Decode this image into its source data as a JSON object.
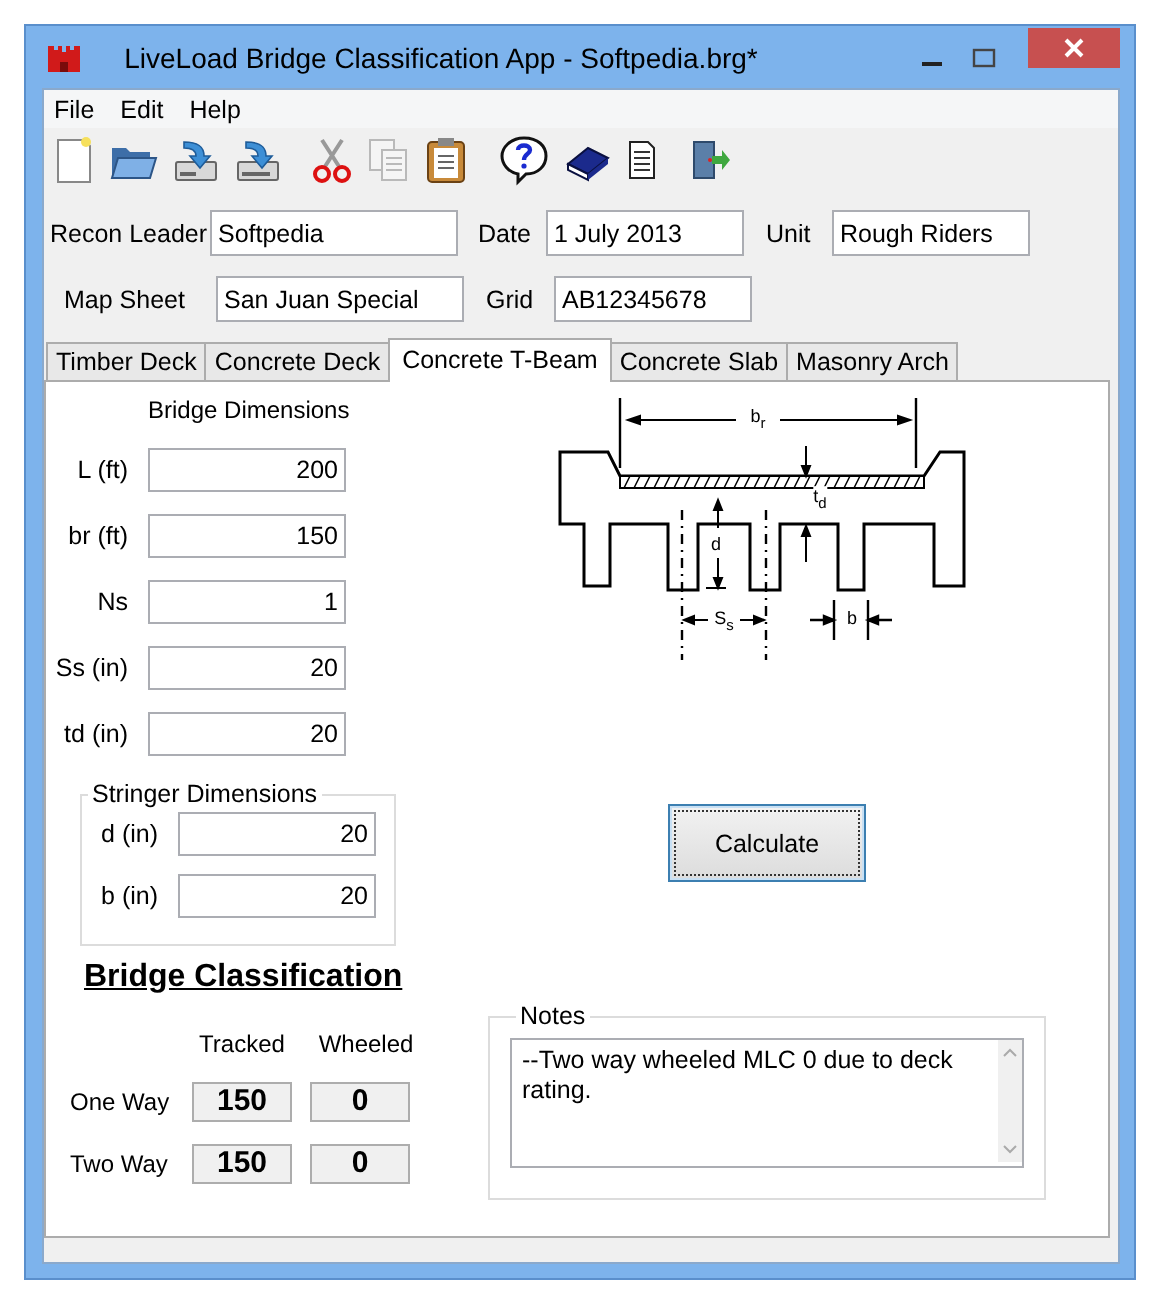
{
  "window": {
    "title": "LiveLoad Bridge Classification App - Softpedia.brg*"
  },
  "menu": [
    "File",
    "Edit",
    "Help"
  ],
  "toolbar": [
    [
      {
        "kind": "new",
        "disabled": false
      },
      {
        "kind": "open",
        "disabled": false
      },
      {
        "kind": "save",
        "disabled": false
      },
      {
        "kind": "saveas",
        "disabled": false
      }
    ],
    [
      {
        "kind": "cut",
        "disabled": false
      },
      {
        "kind": "copy",
        "disabled": true
      },
      {
        "kind": "paste",
        "disabled": false
      }
    ],
    [
      {
        "kind": "help",
        "disabled": false
      },
      {
        "kind": "book",
        "disabled": false
      },
      {
        "kind": "document",
        "disabled": false
      }
    ],
    [
      {
        "kind": "exit",
        "disabled": false
      }
    ]
  ],
  "header_rows": [
    [
      {
        "label": "Recon Leader",
        "value": "Softpedia"
      },
      {
        "label": "Date",
        "value": "1 July 2013"
      },
      {
        "label": "Unit",
        "value": "Rough Riders"
      }
    ],
    [
      {
        "label": "Map Sheet",
        "value": "San Juan Special"
      },
      {
        "label": "Grid",
        "value": "AB12345678"
      }
    ]
  ],
  "tabs": [
    {
      "label": "Timber Deck",
      "selected": false
    },
    {
      "label": "Concrete Deck",
      "selected": false
    },
    {
      "label": "Concrete T-Beam",
      "selected": true
    },
    {
      "label": "Concrete Slab",
      "selected": false
    },
    {
      "label": "Masonry Arch",
      "selected": false
    }
  ],
  "bridge_dimensions": {
    "title": "Bridge Dimensions",
    "fields": [
      {
        "label": "L (ft)",
        "value": "200"
      },
      {
        "label": "br (ft)",
        "value": "150"
      },
      {
        "label": "Ns",
        "value": "1"
      },
      {
        "label": "Ss (in)",
        "value": "20"
      },
      {
        "label": "td (in)",
        "value": "20"
      }
    ]
  },
  "stringer_dimensions": {
    "title": "Stringer Dimensions",
    "fields": [
      {
        "label": "d (in)",
        "value": "20"
      },
      {
        "label": "b (in)",
        "value": "20"
      }
    ]
  },
  "diagram_labels": [
    "b$_{r}$",
    "t$_{d}$",
    "d",
    "S$_{s}$",
    "b"
  ],
  "calculate_button": "Calculate",
  "classification": {
    "title": "Bridge Classification",
    "columns": [
      "Tracked",
      "Wheeled"
    ],
    "rows": [
      {
        "label": "One Way",
        "values": [
          "150",
          "0"
        ]
      },
      {
        "label": "Two Way",
        "values": [
          "150",
          "0"
        ]
      }
    ]
  },
  "notes": {
    "title": "Notes",
    "text": "--Two way wheeled MLC 0 due to deck rating."
  }
}
